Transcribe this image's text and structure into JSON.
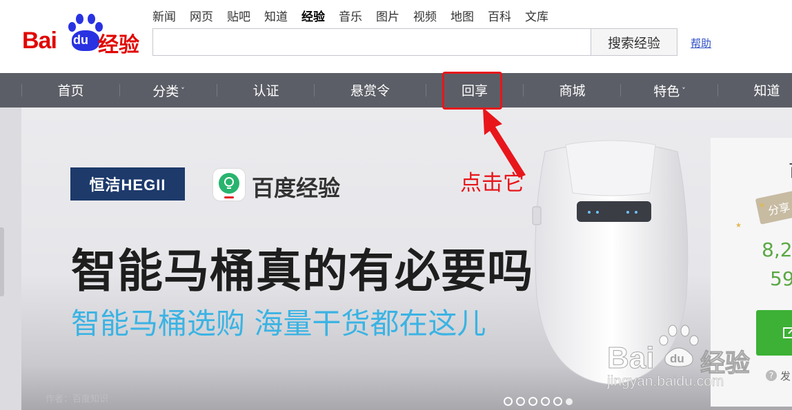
{
  "header": {
    "logo_text": "Bai",
    "logo_du": "du",
    "logo_jy": "经验",
    "topnav": [
      {
        "label": "新闻"
      },
      {
        "label": "网页"
      },
      {
        "label": "贴吧"
      },
      {
        "label": "知道"
      },
      {
        "label": "经验",
        "active": true
      },
      {
        "label": "音乐"
      },
      {
        "label": "图片"
      },
      {
        "label": "视频"
      },
      {
        "label": "地图"
      },
      {
        "label": "百科"
      },
      {
        "label": "文库"
      }
    ],
    "search_value": "",
    "search_button": "搜索经验",
    "help_link": "帮助"
  },
  "mainnav": {
    "items": [
      {
        "label": "首页"
      },
      {
        "label": "分类",
        "caret": "˅"
      },
      {
        "label": "认证"
      },
      {
        "label": "悬赏令"
      },
      {
        "label": "回享"
      },
      {
        "label": "商城"
      },
      {
        "label": "特色",
        "caret": "˅"
      },
      {
        "label": "知道"
      }
    ]
  },
  "banner": {
    "partner_logo": "恒洁HEGII",
    "app_name": "百度经验",
    "title": "智能马桶真的有必要吗",
    "subtitle": "智能马桶选购 海量干货都在这儿",
    "author": "作者：百度知识"
  },
  "annotation": {
    "text": "点击它",
    "color": "#e8161b"
  },
  "side_panel": {
    "letter": "百",
    "ribbon": "分享",
    "stat1": "8,2",
    "stat2": "59",
    "footer": "发"
  },
  "carousel": {
    "dots": 6,
    "active": 5
  },
  "watermark": {
    "bai": "Bai",
    "du": "du",
    "jy": "经验",
    "url": "jingyan.baidu.com"
  },
  "colors": {
    "brand_red": "#e10602",
    "brand_blue": "#2932e1",
    "nav_bg": "#5b5e66",
    "green": "#5aa843"
  }
}
